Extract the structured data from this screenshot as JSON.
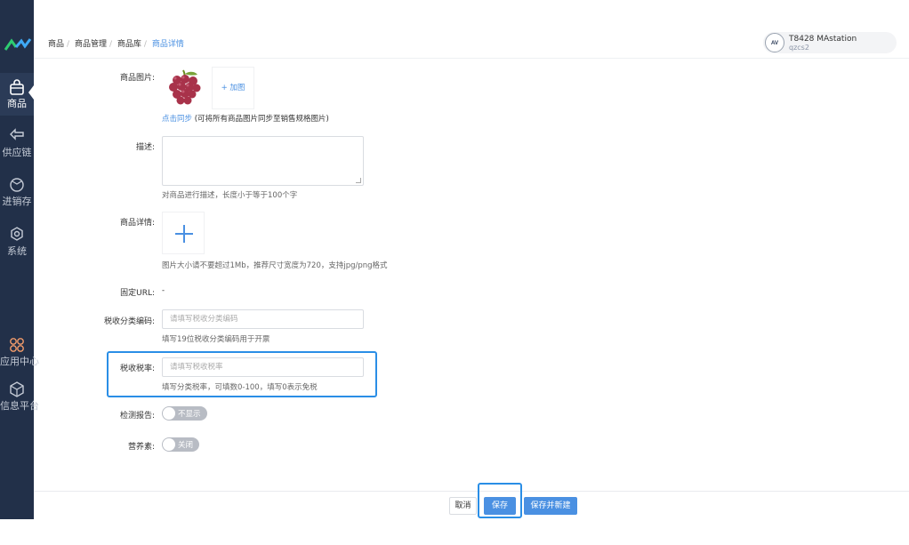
{
  "sidebar": {
    "items": [
      {
        "label": "商品",
        "icon": "bag-icon"
      },
      {
        "label": "供应链",
        "icon": "exchange-icon"
      },
      {
        "label": "进销存",
        "icon": "cube-icon"
      },
      {
        "label": "系统",
        "icon": "gear-icon"
      },
      {
        "label": "应用中心",
        "icon": "apps-icon"
      },
      {
        "label": "信息平台",
        "icon": "box-icon"
      }
    ]
  },
  "breadcrumb": [
    "商品",
    "商品管理",
    "商品库",
    "商品详情"
  ],
  "user": {
    "name": "T8428 MAstation",
    "sub": "qzcs2",
    "avatar_text": "AV"
  },
  "form": {
    "image_label": "商品图片:",
    "add_image": "+ 加图",
    "sync_link": "点击同步",
    "sync_hint": " (可将所有商品图片同步至销售规格图片)",
    "desc_label": "描述:",
    "desc_hint": "对商品进行描述，长度小于等于100个字",
    "detail_label": "商品详情:",
    "detail_hint": "图片大小请不要超过1Mb，推荐尺寸宽度为720，支持jpg/png格式",
    "url_label": "固定URL:",
    "url_value": "-",
    "tax_code_label": "税收分类编码:",
    "tax_code_placeholder": "请填写税收分类编码",
    "tax_code_hint": "填写19位税收分类编码用于开票",
    "tax_rate_label": "税收税率:",
    "tax_rate_placeholder": "请填写税收税率",
    "tax_rate_hint": "填写分类税率，可填数0-100，填写0表示免税",
    "report_label": "检测报告:",
    "report_toggle": "不显示",
    "nutrition_label": "营养素:",
    "nutrition_toggle": "关闭"
  },
  "footer": {
    "cancel": "取消",
    "save": "保存",
    "save_new": "保存并新建"
  },
  "colors": {
    "sidebar": "#223049",
    "accent": "#4a90e2",
    "highlight": "#2a8ee6"
  }
}
